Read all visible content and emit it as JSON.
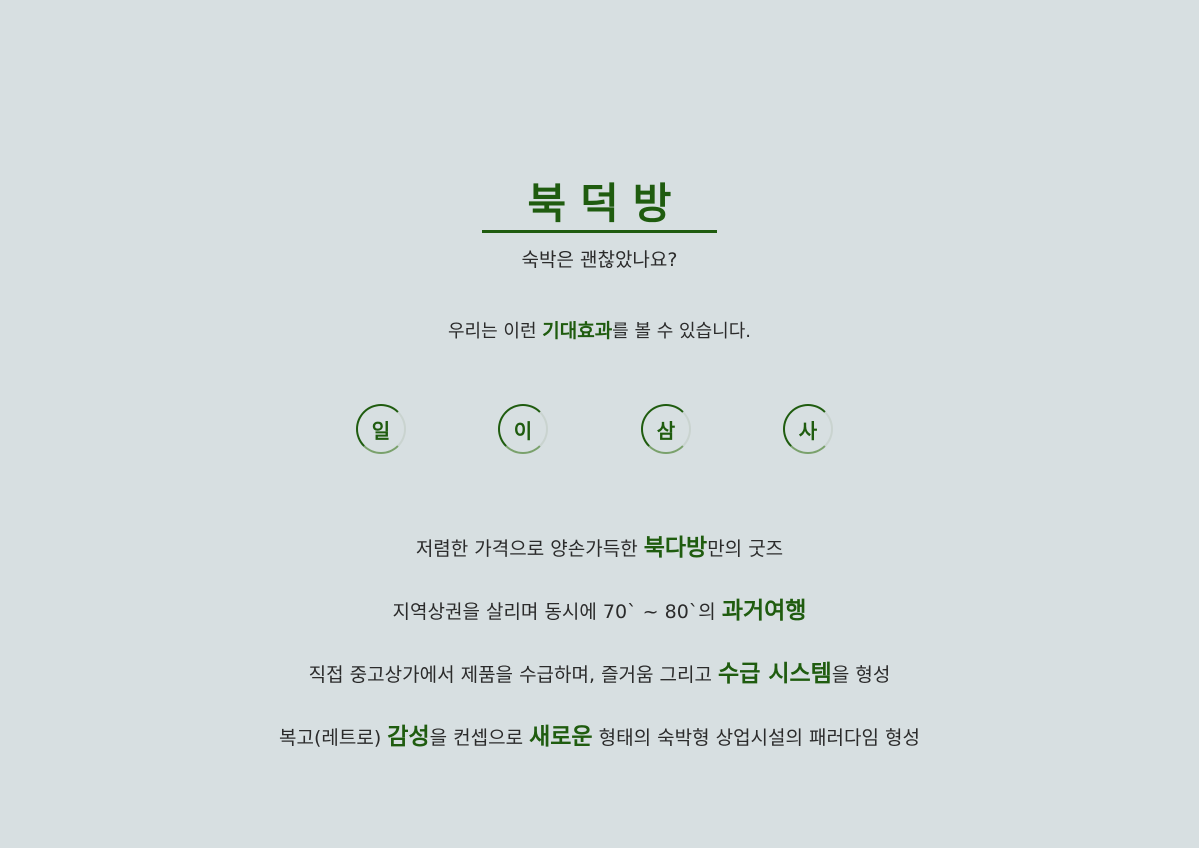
{
  "hero": {
    "brand": "북덕방",
    "tagline": "숙박은 괜찮았나요?"
  },
  "intro": {
    "before": "우리는 이런 ",
    "highlight": "기대효과",
    "after": "를 볼 수 있습니다."
  },
  "circles": [
    "일",
    "이",
    "삼",
    "사"
  ],
  "effects": [
    {
      "before": "저렴한 가격으로 양손가득한 ",
      "highlight": "북다방",
      "after": "만의 굿즈"
    },
    {
      "before": "지역상권을 살리며 동시에 70` ~ 80`의 ",
      "highlight": "과거여행",
      "after": ""
    },
    {
      "before": "직접 중고상가에서 제품을 수급하며, 즐거움 그리고 ",
      "highlight": "수급 시스템",
      "after": "을 형성"
    },
    {
      "before": "복고(레트로) ",
      "highlight": "감성",
      "middle": "을 컨셉으로 ",
      "highlight2": "새로운",
      "after": " 형태의 숙박형 상업시설의 패러다임 형성"
    }
  ],
  "colors": {
    "background": "#d7dfe1",
    "accent": "#1f5c0f",
    "text": "#2b2b2b"
  }
}
